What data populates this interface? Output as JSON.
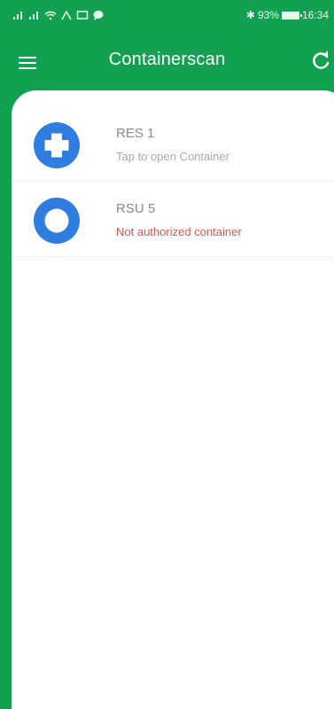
{
  "status_bar": {
    "battery_text": "93%",
    "time": "16:34"
  },
  "app_bar": {
    "title": "Containerscan",
    "menu_icon": "menu-icon",
    "refresh_icon": "refresh-icon"
  },
  "colors": {
    "primary": "#12a150",
    "accent_blue": "#2f7de1",
    "error_red": "#d9534f"
  },
  "containers": [
    {
      "name": "RES 1",
      "status": "Tap to open Container",
      "icon": "plus-circle-icon",
      "authorized": true
    },
    {
      "name": "RSU 5",
      "status": "Not authorized container",
      "icon": "ring-icon",
      "authorized": false
    }
  ]
}
